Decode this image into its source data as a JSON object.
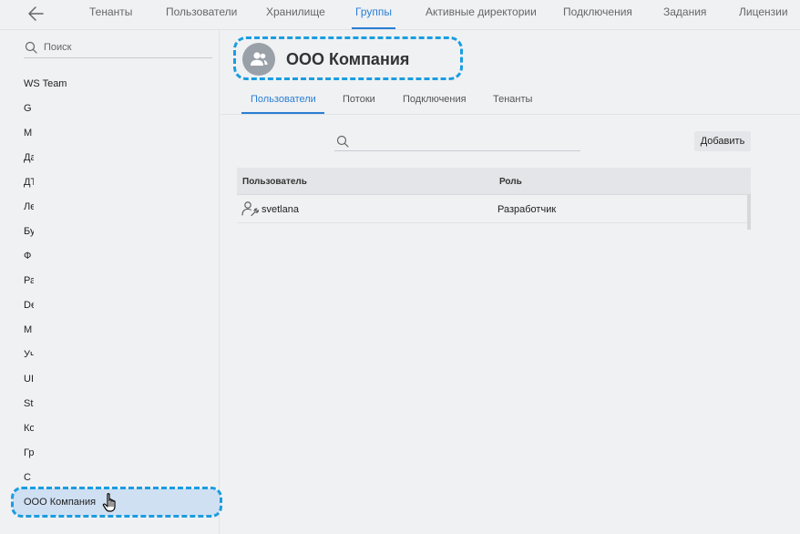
{
  "topnav": {
    "tabs": [
      {
        "label": "Тенанты"
      },
      {
        "label": "Пользователи"
      },
      {
        "label": "Хранилище"
      },
      {
        "label": "Группы"
      },
      {
        "label": "Активные директории"
      },
      {
        "label": "Подключения"
      },
      {
        "label": "Задания"
      },
      {
        "label": "Лицензии"
      }
    ]
  },
  "sidebar": {
    "search_placeholder": "Поиск",
    "groups": [
      {
        "label": "WS Team"
      },
      {
        "label": "G"
      },
      {
        "label": "M"
      },
      {
        "label": "Да"
      },
      {
        "label": "ДТ"
      },
      {
        "label": "Ле"
      },
      {
        "label": "Бу"
      },
      {
        "label": "Ф"
      },
      {
        "label": "Ра"
      },
      {
        "label": "De"
      },
      {
        "label": "M"
      },
      {
        "label": "Уч"
      },
      {
        "label": "UI"
      },
      {
        "label": "St"
      },
      {
        "label": "Ко"
      },
      {
        "label": "Гр"
      },
      {
        "label": "С"
      },
      {
        "label": "ООО Компания"
      }
    ]
  },
  "main": {
    "title": "ООО Компания",
    "tabs": [
      {
        "label": "Пользователи"
      },
      {
        "label": "Потоки"
      },
      {
        "label": "Подключения"
      },
      {
        "label": "Тенанты"
      }
    ],
    "add_label": "Добавить",
    "table": {
      "headers": [
        "Пользователь",
        "Роль"
      ],
      "rows": [
        {
          "user": "svetlana",
          "role": "Разработчик"
        }
      ]
    }
  },
  "colors": {
    "accent": "#2a7fd4",
    "highlight_dash": "#1a9de0",
    "selected_bg": "#cfe0f3"
  },
  "icons": {
    "back": "arrow-left-icon",
    "search": "search-icon",
    "group_avatar": "users-icon",
    "user_row": "user-wrench-icon",
    "cursor": "hand-pointer-icon"
  }
}
